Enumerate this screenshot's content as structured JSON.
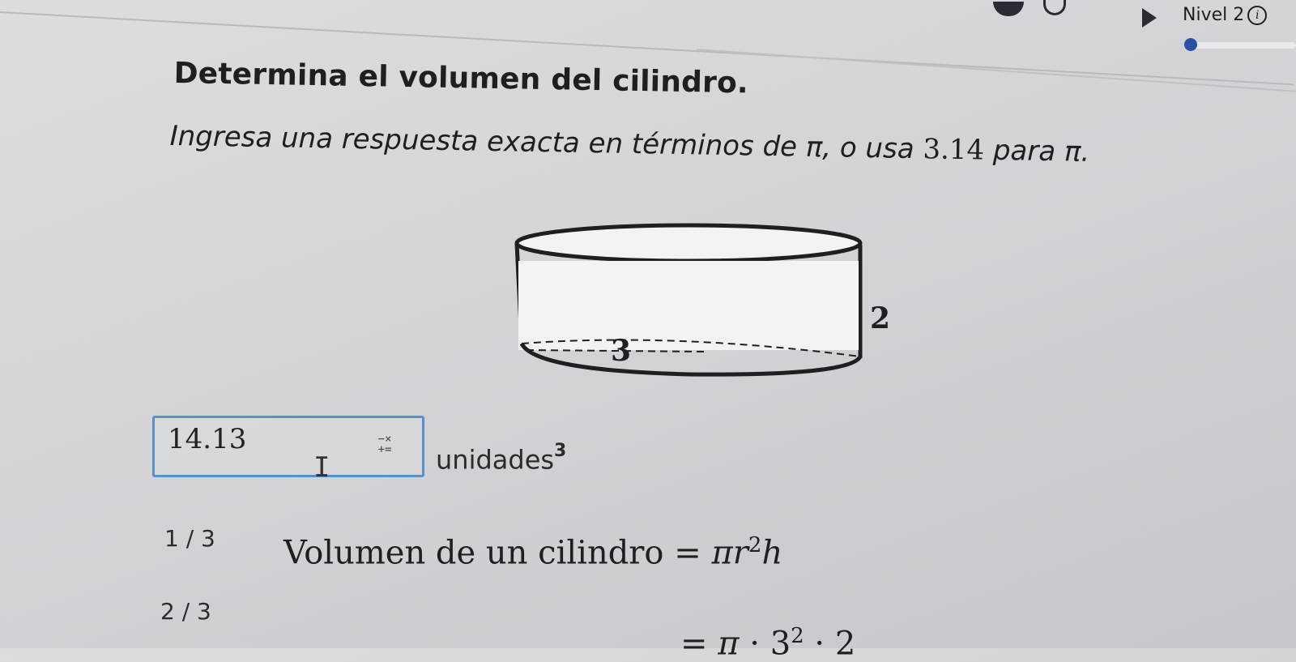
{
  "header": {
    "level_label": "Nivel 2",
    "info_icon": "info-icon",
    "play_icon": "play-icon"
  },
  "problem": {
    "title": "Determina el volumen del cilindro.",
    "instruction_before": "Ingresa una respuesta exacta en términos de π, o usa ",
    "instruction_number": "3.14",
    "instruction_after": " para π."
  },
  "figure": {
    "height_label": "2",
    "radius_label": "3"
  },
  "answer": {
    "value": "14.13",
    "units_label": "unidades",
    "units_exponent": "3",
    "keypad_icon_top": "−×",
    "keypad_icon_bottom": "+="
  },
  "steps": [
    {
      "counter": "1 / 3",
      "text_label": "Volumen de un cilindro",
      "equals": "=",
      "formula_pi": "π",
      "formula_r": "r",
      "formula_exp": "2",
      "formula_h": "h"
    },
    {
      "counter": "2 / 3",
      "equals": "=",
      "formula_pi": "π",
      "dot1": "·",
      "base": "3",
      "exp": "2",
      "dot2": "·",
      "height": "2"
    }
  ],
  "colors": {
    "input_border": "#5a90c6",
    "level_dot": "#2d4fa6"
  }
}
